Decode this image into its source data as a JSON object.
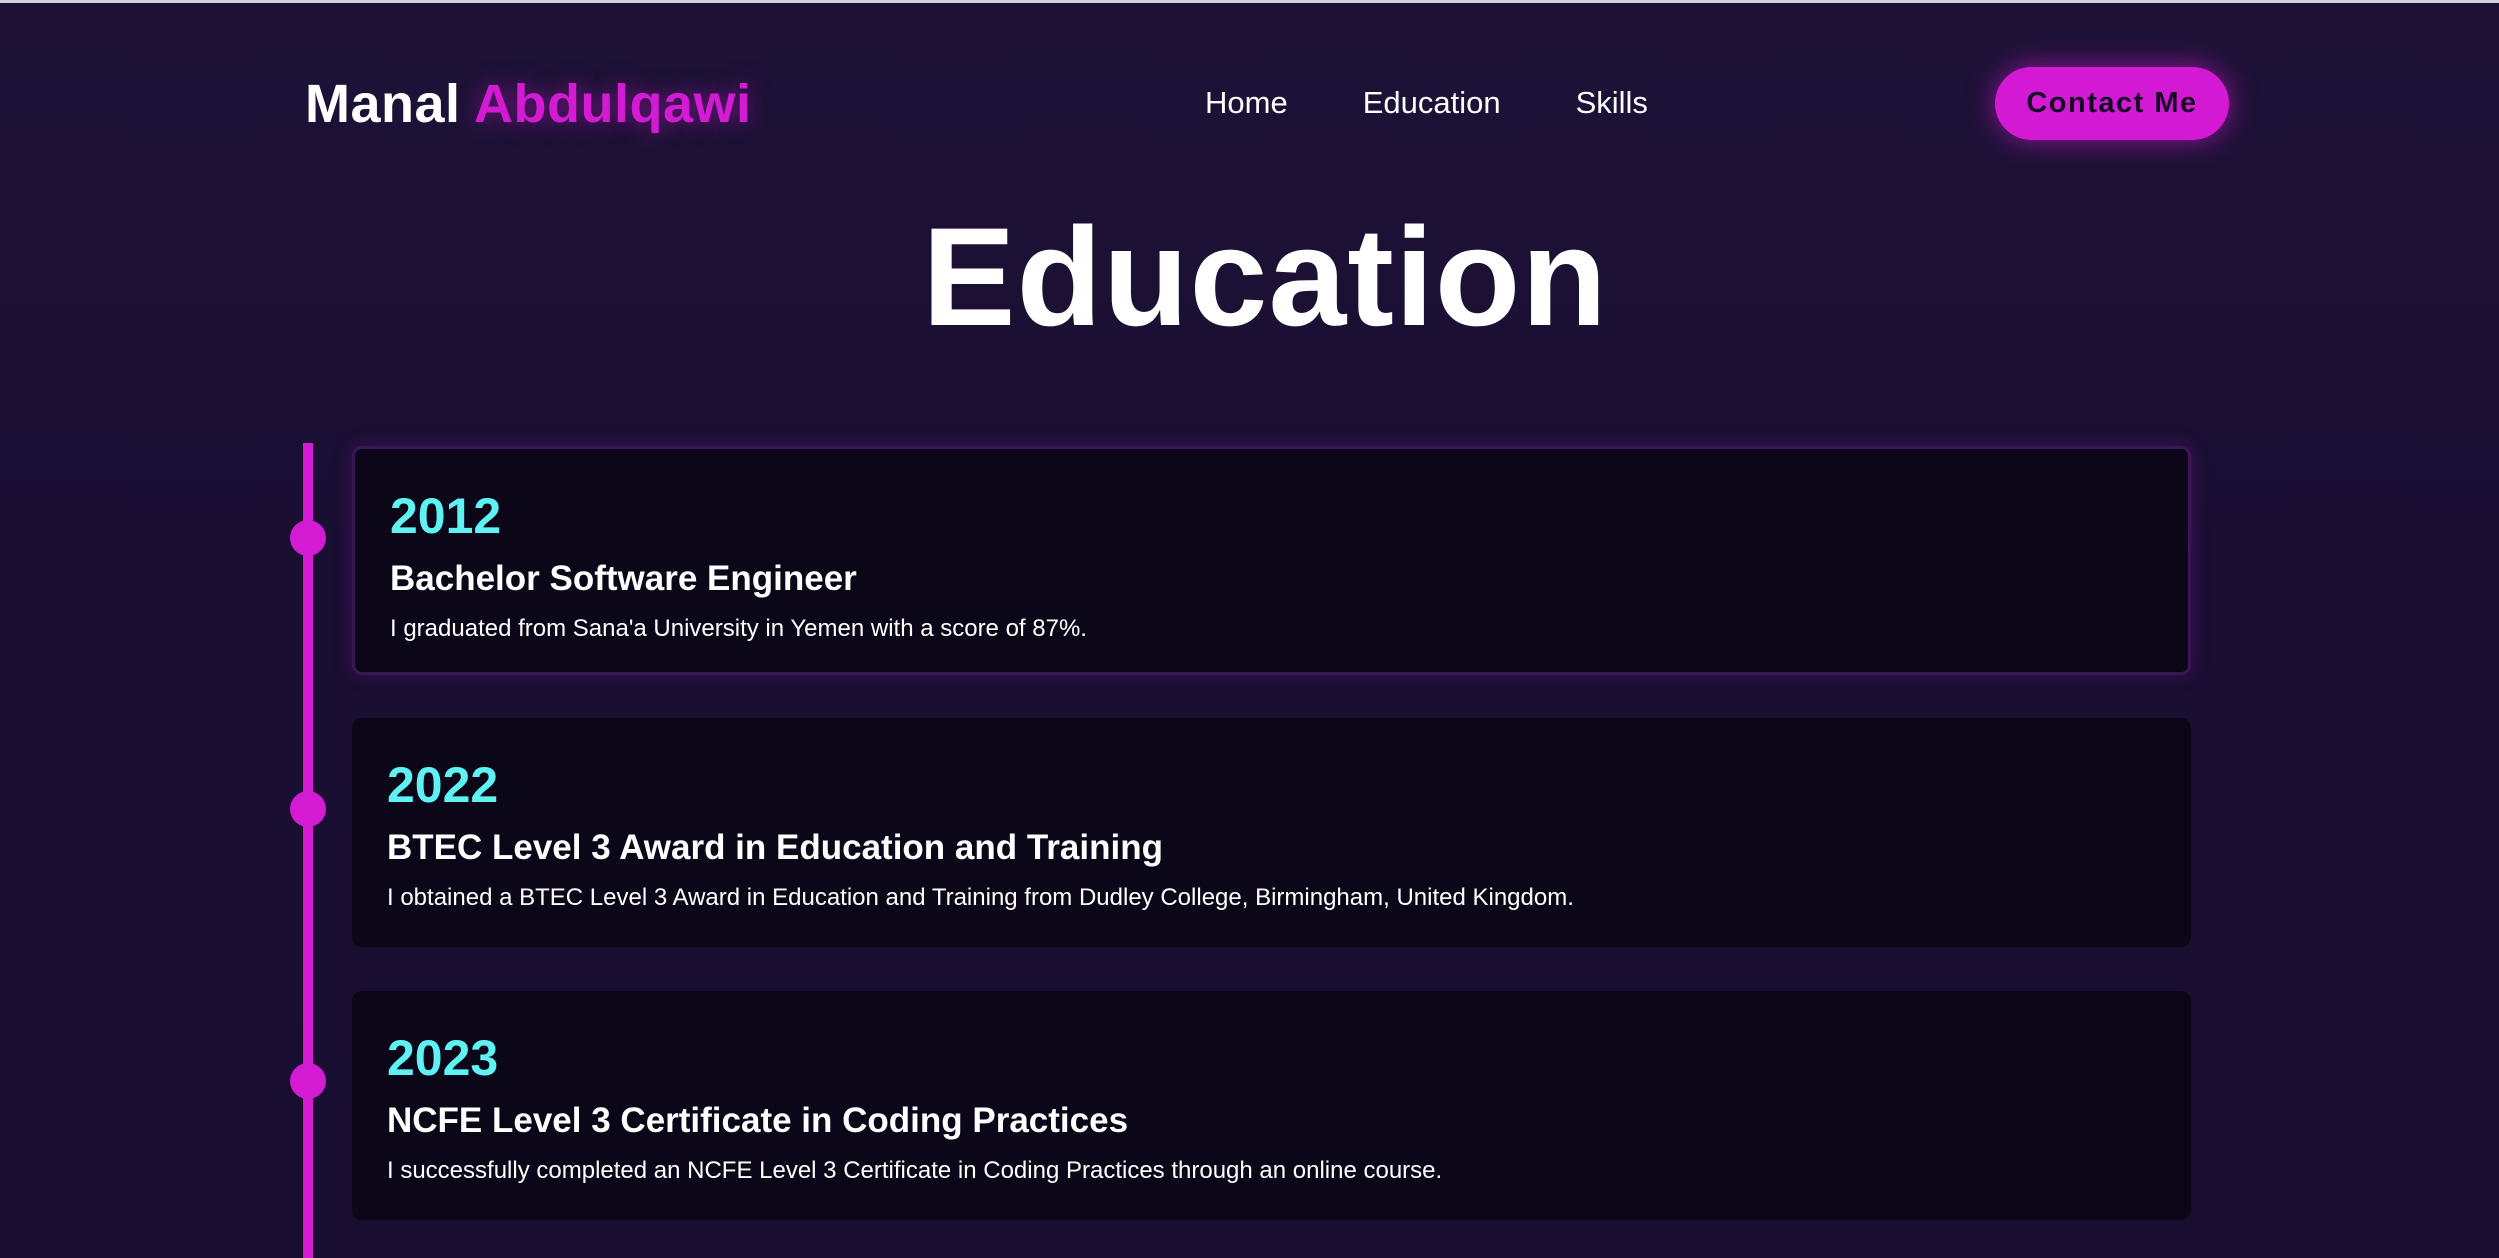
{
  "header": {
    "logo_first": "Manal",
    "logo_last": "Abdulqawi",
    "nav": [
      "Home",
      "Education",
      "Skills"
    ],
    "contact_label": "Contact Me"
  },
  "section_title": "Education",
  "timeline": [
    {
      "year": "2012",
      "degree": "Bachelor Software Engineer",
      "description": "I graduated from Sana'a University in Yemen with a score of 87%."
    },
    {
      "year": "2022",
      "degree": "BTEC Level 3 Award in Education and Training",
      "description": "I obtained a BTEC Level 3 Award in Education and Training from Dudley College, Birmingham, United Kingdom."
    },
    {
      "year": "2023",
      "degree": "NCFE Level 3 Certificate in Coding Practices",
      "description": "I successfully completed an NCFE Level 3 Certificate in Coding Practices through an online course."
    }
  ],
  "colors": {
    "accent": "#d21bd2",
    "year": "#5ff2f2",
    "background": "#1a0e33",
    "card": "#0c0718"
  }
}
